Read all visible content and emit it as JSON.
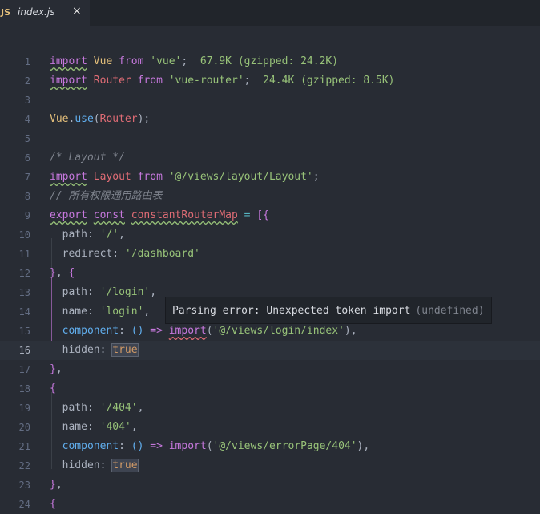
{
  "tab": {
    "icon_text": "JS",
    "icon": "js-file-icon",
    "title": "index.js",
    "close_glyph": "×",
    "close_icon": "close-icon"
  },
  "editor": {
    "lines": [
      {
        "n": "1",
        "text": "import Vue from 'vue';  67.9K (gzipped: 24.2K)"
      },
      {
        "n": "2",
        "text": "import Router from 'vue-router';  24.4K (gzipped: 8.5K)"
      },
      {
        "n": "3",
        "text": ""
      },
      {
        "n": "4",
        "text": "Vue.use(Router);"
      },
      {
        "n": "5",
        "text": ""
      },
      {
        "n": "6",
        "text": "/* Layout */"
      },
      {
        "n": "7",
        "text": "import Layout from '@/views/layout/Layout';"
      },
      {
        "n": "8",
        "text": "// 所有权限通用路由表"
      },
      {
        "n": "9",
        "text": "export const constantRouterMap = [{"
      },
      {
        "n": "10",
        "text": "  path: '/',"
      },
      {
        "n": "11",
        "text": "  redirect: '/dashboard'"
      },
      {
        "n": "12",
        "text": "}, {"
      },
      {
        "n": "13",
        "text": "  path: '/login',"
      },
      {
        "n": "14",
        "text": "  name: 'login',"
      },
      {
        "n": "15",
        "text": "  component: () => import('@/views/login/index'),"
      },
      {
        "n": "16",
        "text": "  hidden: true"
      },
      {
        "n": "17",
        "text": "},"
      },
      {
        "n": "18",
        "text": "{"
      },
      {
        "n": "19",
        "text": "  path: '/404',"
      },
      {
        "n": "20",
        "text": "  name: '404',"
      },
      {
        "n": "21",
        "text": "  component: () => import('@/views/errorPage/404'),"
      },
      {
        "n": "22",
        "text": "  hidden: true"
      },
      {
        "n": "23",
        "text": "},"
      },
      {
        "n": "24",
        "text": "{"
      }
    ],
    "current_line": "16"
  },
  "tooltip": {
    "message": "Parsing error: Unexpected token import",
    "source": "(undefined)"
  },
  "colors": {
    "background": "#282c34",
    "keyword": "#c678dd",
    "string": "#98c379",
    "function": "#61afef",
    "class": "#e5c07b",
    "variable": "#e06c75",
    "error_squiggle": "#e06c75"
  }
}
